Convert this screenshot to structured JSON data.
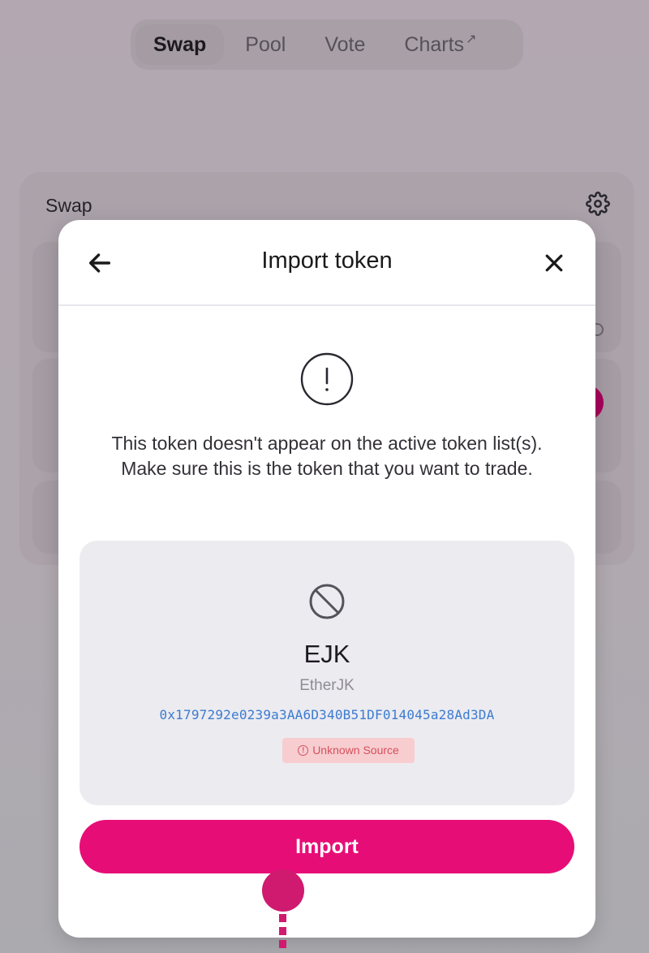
{
  "nav": {
    "tabs": [
      {
        "label": "Swap",
        "active": true
      },
      {
        "label": "Pool",
        "active": false
      },
      {
        "label": "Vote",
        "active": false
      },
      {
        "label": "Charts",
        "active": false,
        "icon": "external-arrow-icon"
      }
    ]
  },
  "swap_card": {
    "title": "Swap",
    "settings_icon": "gear-icon"
  },
  "modal": {
    "title": "Import token",
    "back_icon": "arrow-left-icon",
    "close_icon": "close-icon",
    "warning_icon": "alert-circle-icon",
    "warning_text": "This token doesn't appear on the active token list(s). Make sure this is the token that you want to trade.",
    "token": {
      "icon": "ban-icon",
      "symbol": "EJK",
      "name": "EtherJK",
      "address": "0x1797292e0239a3AA6D340B51DF014045a28Ad3DA",
      "source_badge": "Unknown Source"
    },
    "import_button": "Import"
  },
  "colors": {
    "accent": "#e70d77",
    "address": "#3b7bd1",
    "badge_bg": "#f7cdd0",
    "badge_text": "#d6505c",
    "annotation": "#cf1a6f"
  }
}
